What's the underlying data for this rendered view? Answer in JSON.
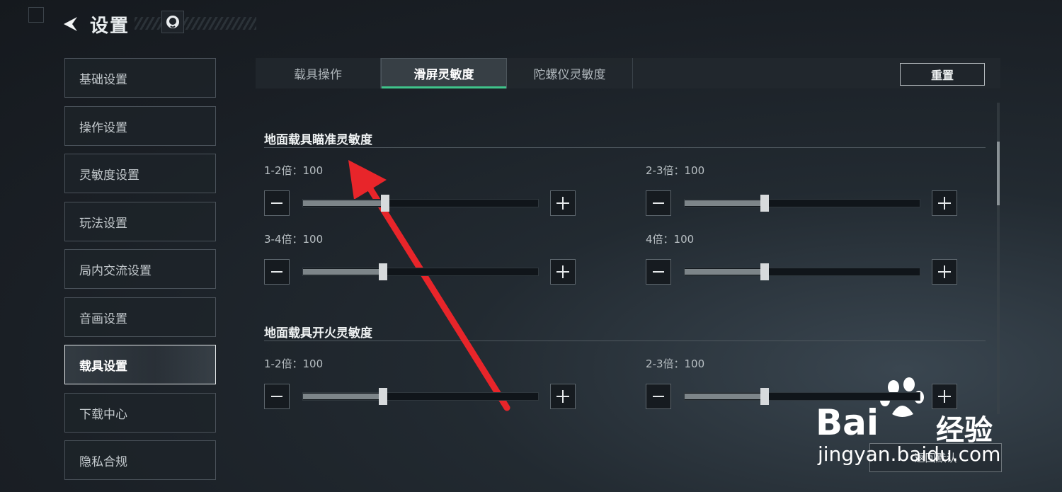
{
  "header": {
    "title": "设置"
  },
  "sidebar": {
    "items": [
      {
        "label": "基础设置"
      },
      {
        "label": "操作设置"
      },
      {
        "label": "灵敏度设置"
      },
      {
        "label": "玩法设置"
      },
      {
        "label": "局内交流设置"
      },
      {
        "label": "音画设置"
      },
      {
        "label": "载具设置",
        "active": true
      },
      {
        "label": "下载中心"
      },
      {
        "label": "隐私合规"
      }
    ]
  },
  "tabs": [
    {
      "label": "载具操作"
    },
    {
      "label": "滑屏灵敏度",
      "active": true
    },
    {
      "label": "陀螺仪灵敏度"
    }
  ],
  "reset_label": "重置",
  "sections": [
    {
      "title": "地面载具瞄准灵敏度",
      "sliders": [
        {
          "label": "1-2倍：100",
          "value": 100,
          "fraction": 0.35
        },
        {
          "label": "2-3倍：100",
          "value": 100,
          "fraction": 0.34
        },
        {
          "label": "3-4倍：100",
          "value": 100,
          "fraction": 0.34
        },
        {
          "label": "4倍：100",
          "value": 100,
          "fraction": 0.34
        }
      ]
    },
    {
      "title": "地面载具开火灵敏度",
      "sliders": [
        {
          "label": "1-2倍：100",
          "value": 100,
          "fraction": 0.34
        },
        {
          "label": "2-3倍：100",
          "value": 100,
          "fraction": 0.34
        }
      ]
    }
  ],
  "bottom_button": "返回默认",
  "watermark": {
    "logo": "Bai",
    "brand": "经验",
    "url": "jingyan.baidu.com"
  },
  "colors": {
    "accent": "#3fc48b",
    "arrow": "#e8252a"
  }
}
